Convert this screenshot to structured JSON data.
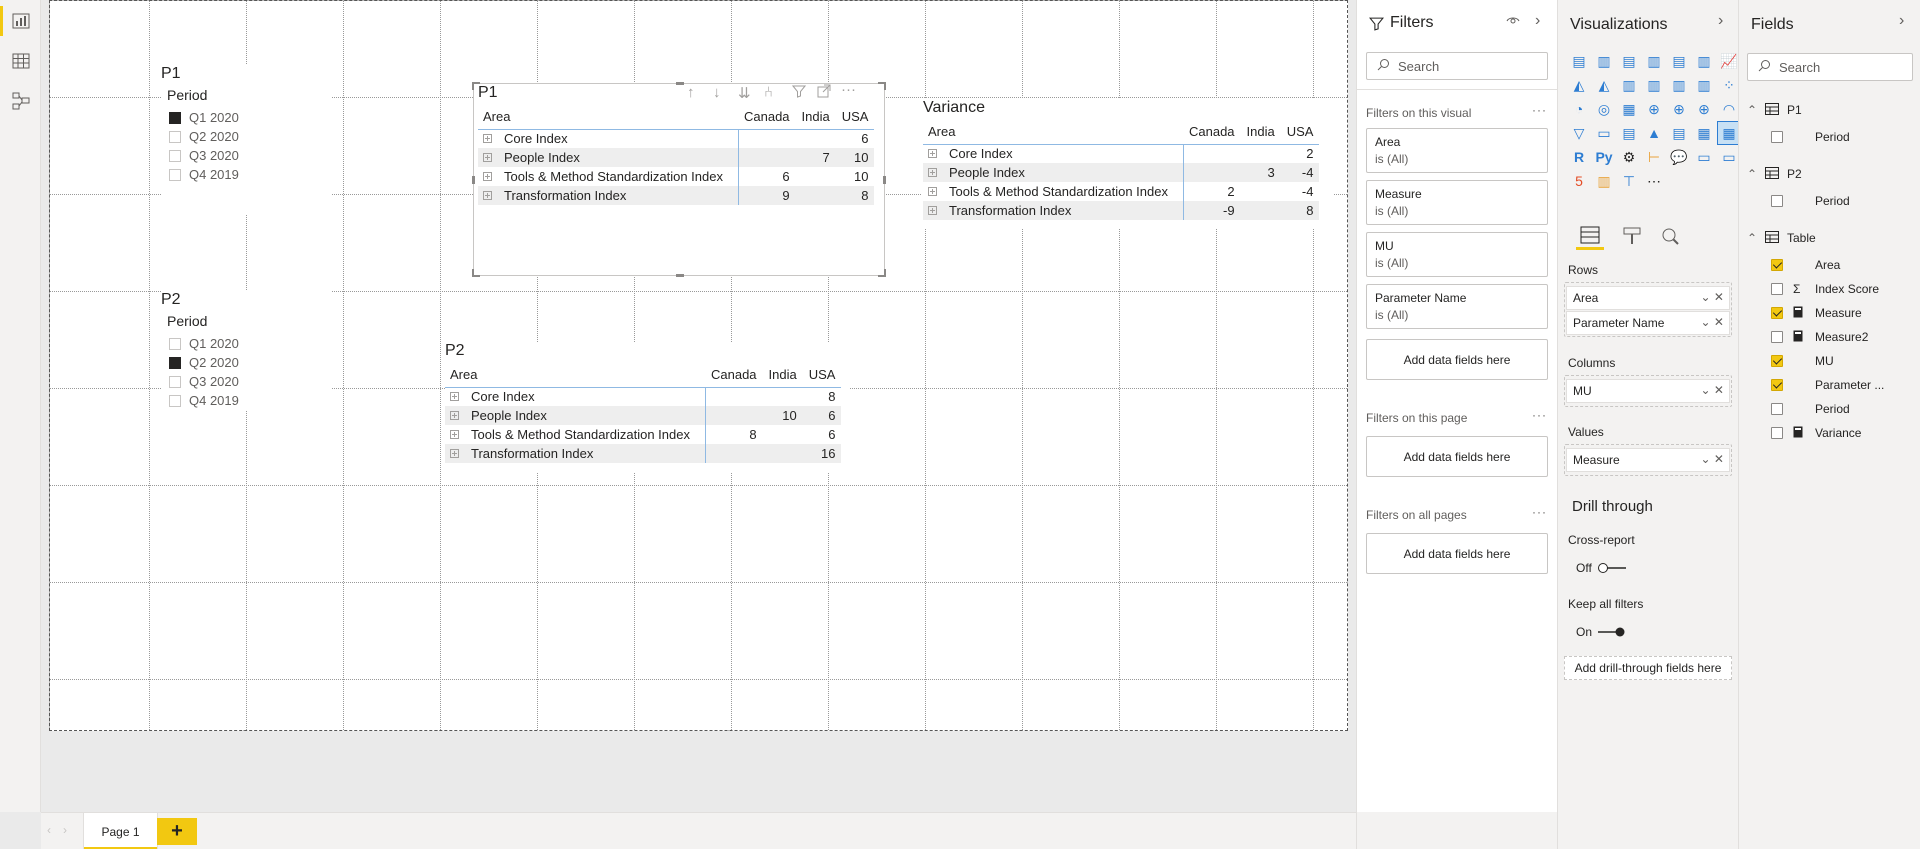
{
  "canvas": {
    "slicer_p1": {
      "title": "P1",
      "header": "Period",
      "items": [
        {
          "label": "Q1 2020",
          "checked": true
        },
        {
          "label": "Q2 2020",
          "checked": false
        },
        {
          "label": "Q3 2020",
          "checked": false
        },
        {
          "label": "Q4 2019",
          "checked": false
        }
      ]
    },
    "slicer_p2": {
      "title": "P2",
      "header": "Period",
      "items": [
        {
          "label": "Q1 2020",
          "checked": false
        },
        {
          "label": "Q2 2020",
          "checked": true
        },
        {
          "label": "Q3 2020",
          "checked": false
        },
        {
          "label": "Q4 2019",
          "checked": false
        }
      ]
    },
    "matrix_p1": {
      "title": "P1",
      "columns": [
        "Area",
        "Canada",
        "India",
        "USA"
      ],
      "rows": [
        [
          "Core Index",
          "",
          "",
          "6"
        ],
        [
          "People Index",
          "",
          "7",
          "10"
        ],
        [
          "Tools & Method Standardization Index",
          "6",
          "",
          "10"
        ],
        [
          "Transformation Index",
          "9",
          "",
          "8"
        ]
      ]
    },
    "matrix_variance": {
      "title": "Variance",
      "columns": [
        "Area",
        "Canada",
        "India",
        "USA"
      ],
      "rows": [
        [
          "Core Index",
          "",
          "",
          "2"
        ],
        [
          "People Index",
          "",
          "3",
          "-4"
        ],
        [
          "Tools & Method Standardization Index",
          "2",
          "",
          "-4"
        ],
        [
          "Transformation Index",
          "-9",
          "",
          "8"
        ]
      ]
    },
    "matrix_p2": {
      "title": "P2",
      "columns": [
        "Area",
        "Canada",
        "India",
        "USA"
      ],
      "rows": [
        [
          "Core Index",
          "",
          "",
          "8"
        ],
        [
          "People Index",
          "",
          "10",
          "6"
        ],
        [
          "Tools & Method Standardization Index",
          "8",
          "",
          "6"
        ],
        [
          "Transformation Index",
          "",
          "",
          "16"
        ]
      ]
    }
  },
  "filters": {
    "title": "Filters",
    "search_placeholder": "Search",
    "on_visual_label": "Filters on this visual",
    "visual_filters": [
      {
        "name": "Area",
        "state": "is (All)"
      },
      {
        "name": "Measure",
        "state": "is (All)"
      },
      {
        "name": "MU",
        "state": "is (All)"
      },
      {
        "name": "Parameter Name",
        "state": "is (All)"
      }
    ],
    "add_fields": "Add data fields here",
    "on_page_label": "Filters on this page",
    "on_all_pages_label": "Filters on all pages"
  },
  "visualizations": {
    "title": "Visualizations",
    "wells": {
      "rows_label": "Rows",
      "rows": [
        "Area",
        "Parameter Name"
      ],
      "columns_label": "Columns",
      "columns": [
        "MU"
      ],
      "values_label": "Values",
      "values": [
        "Measure"
      ]
    },
    "drill": {
      "title": "Drill through",
      "cross_report": "Cross-report",
      "cross_state": "Off",
      "keep_filters": "Keep all filters",
      "keep_state": "On",
      "add_drill": "Add drill-through fields here"
    }
  },
  "fields": {
    "title": "Fields",
    "search_placeholder": "Search",
    "tables": [
      {
        "name": "P1",
        "fields": [
          {
            "label": "Period",
            "checked": false,
            "kind": ""
          }
        ]
      },
      {
        "name": "P2",
        "fields": [
          {
            "label": "Period",
            "checked": false,
            "kind": ""
          }
        ]
      },
      {
        "name": "Table",
        "fields": [
          {
            "label": "Area",
            "checked": true,
            "kind": ""
          },
          {
            "label": "Index Score",
            "checked": false,
            "kind": "sigma"
          },
          {
            "label": "Measure",
            "checked": true,
            "kind": "calc"
          },
          {
            "label": "Measure2",
            "checked": false,
            "kind": "calc"
          },
          {
            "label": "MU",
            "checked": true,
            "kind": ""
          },
          {
            "label": "Parameter ...",
            "checked": true,
            "kind": ""
          },
          {
            "label": "Period",
            "checked": false,
            "kind": ""
          },
          {
            "label": "Variance",
            "checked": false,
            "kind": "calc"
          }
        ]
      }
    ]
  },
  "bottom": {
    "page_tab": "Page 1"
  },
  "colors": {
    "accent": "#f2c811",
    "matrix_rule": "#8fb9e3"
  }
}
